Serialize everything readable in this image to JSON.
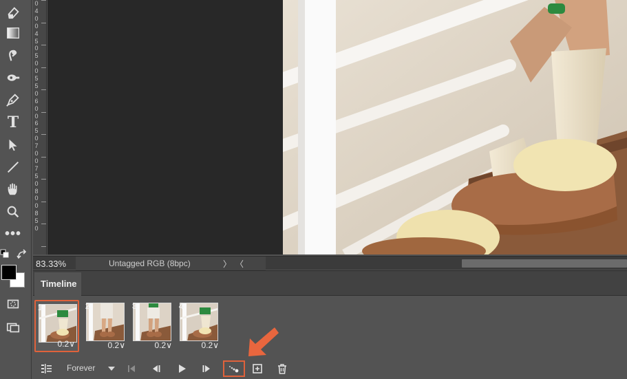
{
  "tools": [
    {
      "name": "eraser-icon"
    },
    {
      "name": "gradient-icon"
    },
    {
      "name": "smudge-icon"
    },
    {
      "name": "dodge-icon"
    },
    {
      "name": "pen-icon"
    },
    {
      "name": "type-icon",
      "glyph": "T"
    },
    {
      "name": "path-selection-icon"
    },
    {
      "name": "line-icon"
    },
    {
      "name": "hand-icon"
    },
    {
      "name": "zoom-icon"
    },
    {
      "name": "more-tools-icon",
      "glyph": "•••"
    }
  ],
  "ruler": {
    "labels": [
      "0",
      "4",
      "0",
      "0",
      "4",
      "5",
      "0",
      "5",
      "0",
      "0",
      "5",
      "5",
      "0",
      "6",
      "0",
      "0",
      "6",
      "5",
      "0",
      "7",
      "0",
      "0",
      "7",
      "5",
      "0",
      "8",
      "0",
      "0",
      "8",
      "5",
      "0"
    ]
  },
  "colors": {
    "foreground": "#000000",
    "background": "#ffffff",
    "accent": "#e0623b"
  },
  "status": {
    "zoom": "83.33%",
    "doc_info": "Untagged RGB (8bpc)",
    "expand_glyph": "〉",
    "collapse_glyph": "〈"
  },
  "timeline": {
    "tab_label": "Timeline",
    "frames": [
      {
        "number": "1",
        "delay": "0.2",
        "selected": true
      },
      {
        "number": "2",
        "delay": "0.2",
        "selected": false
      },
      {
        "number": "3",
        "delay": "0.2",
        "selected": false
      },
      {
        "number": "4",
        "delay": "0.2",
        "selected": false
      }
    ],
    "delay_chevron": "∨",
    "loop_option": "Forever",
    "controls": [
      "convert-timeline-icon",
      "first-frame-icon",
      "previous-frame-icon",
      "play-icon",
      "next-frame-icon",
      "tween-icon",
      "duplicate-frame-icon",
      "delete-frame-icon"
    ]
  }
}
